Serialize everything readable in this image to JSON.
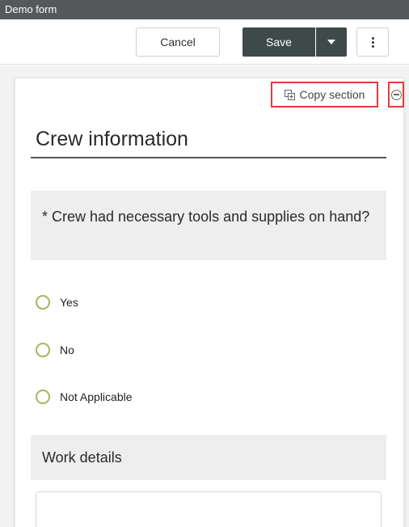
{
  "window": {
    "title": "Demo form"
  },
  "toolbar": {
    "cancel_label": "Cancel",
    "save_label": "Save",
    "save_menu_icon": "caret-down-icon",
    "more_icon": "vertical-ellipsis-icon"
  },
  "section": {
    "copy_label": "Copy section",
    "copy_icon": "copy-section-icon",
    "collapse_icon": "minus-circle-icon",
    "title": "Crew information",
    "question": "* Crew had necessary tools and supplies on hand?",
    "options": [
      "Yes",
      "No",
      "Not Applicable"
    ],
    "work_label": "Work details"
  },
  "colors": {
    "titlebar": "#55595c",
    "save_button": "#3e4a4a",
    "highlight_border": "#e23b3b",
    "radio_border": "#a9b35f",
    "question_bg": "#eeeeee"
  }
}
